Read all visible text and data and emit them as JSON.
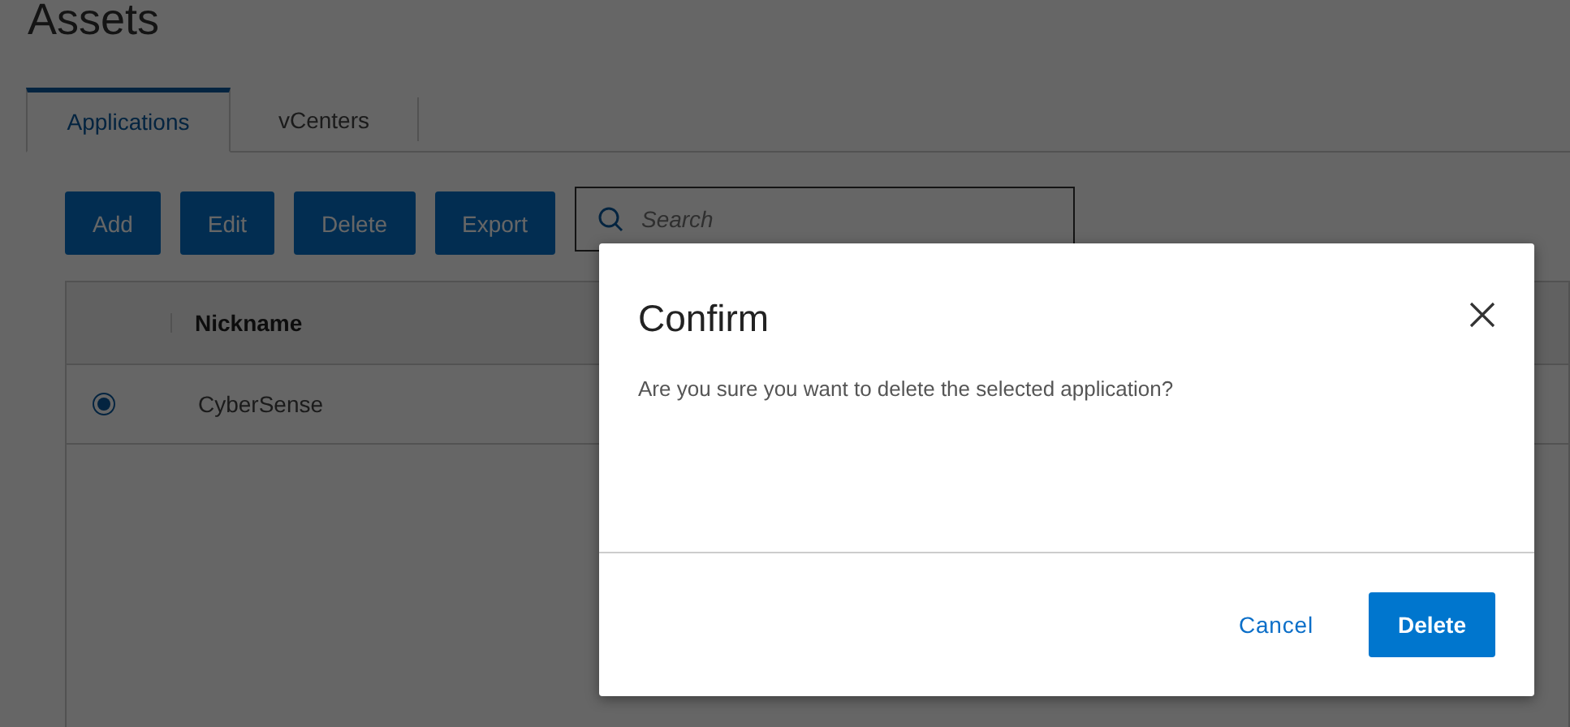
{
  "page": {
    "title": "Assets"
  },
  "tabs": [
    {
      "label": "Applications",
      "selected": true
    },
    {
      "label": "vCenters",
      "selected": false
    }
  ],
  "toolbar": {
    "buttons": [
      "Add",
      "Edit",
      "Delete",
      "Export"
    ],
    "search": {
      "placeholder": "Search"
    }
  },
  "table": {
    "columns": [
      "Nickname"
    ],
    "rows": [
      {
        "selected": true,
        "cells": [
          "CyberSense"
        ]
      }
    ]
  },
  "dialog": {
    "title": "Confirm",
    "message": "Are you sure you want to delete the selected application?",
    "buttons": [
      {
        "label": "Cancel",
        "kind": "secondary"
      },
      {
        "label": "Delete",
        "kind": "primary"
      }
    ]
  }
}
